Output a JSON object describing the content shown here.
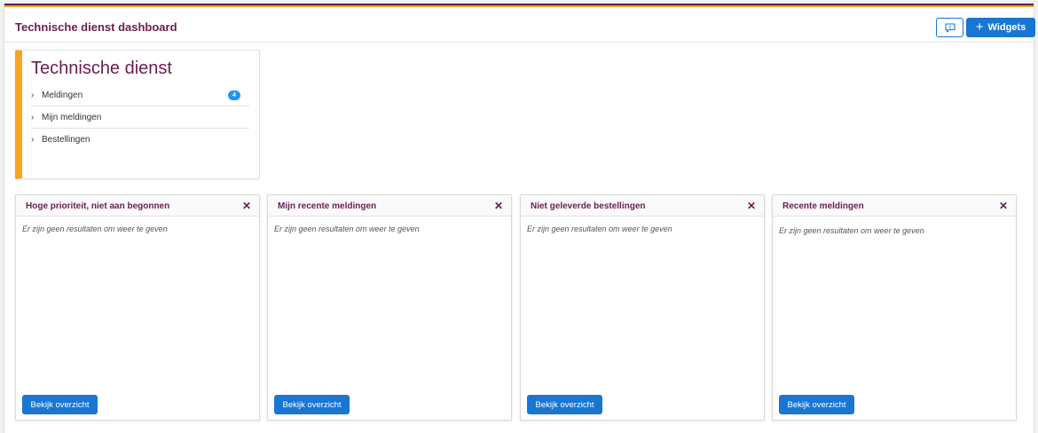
{
  "header": {
    "title": "Technische dienst dashboard",
    "widgets_label": "Widgets"
  },
  "nav_card": {
    "title": "Technische dienst",
    "items": [
      {
        "label": "Meldingen",
        "badge": "4"
      },
      {
        "label": "Mijn meldingen"
      },
      {
        "label": "Bestellingen"
      }
    ]
  },
  "widgets": [
    {
      "title": "Hoge prioriteit, niet aan begonnen",
      "empty": "Er zijn geen resultaten om weer te geven",
      "button": "Bekijk overzicht"
    },
    {
      "title": "Mijn recente meldingen",
      "empty": "Er zijn geen resultaten om weer te geven",
      "button": "Bekijk overzicht"
    },
    {
      "title": "Niet geleverde bestellingen",
      "empty": "Er zijn geen resultaten om weer te geven",
      "button": "Bekijk overzicht"
    },
    {
      "title": "Recente meldingen",
      "empty": "Er zijn geen resultaten om weer te geven",
      "button": "Bekijk overzicht"
    }
  ],
  "icons": {
    "feedback": "chat-icon",
    "add": "plus-icon",
    "close": "close-icon",
    "expand": "chevron-right-icon"
  },
  "colors": {
    "brand": "#6a1d50",
    "accent": "#f5a623",
    "primary": "#1976d2",
    "badge": "#2196f3"
  }
}
